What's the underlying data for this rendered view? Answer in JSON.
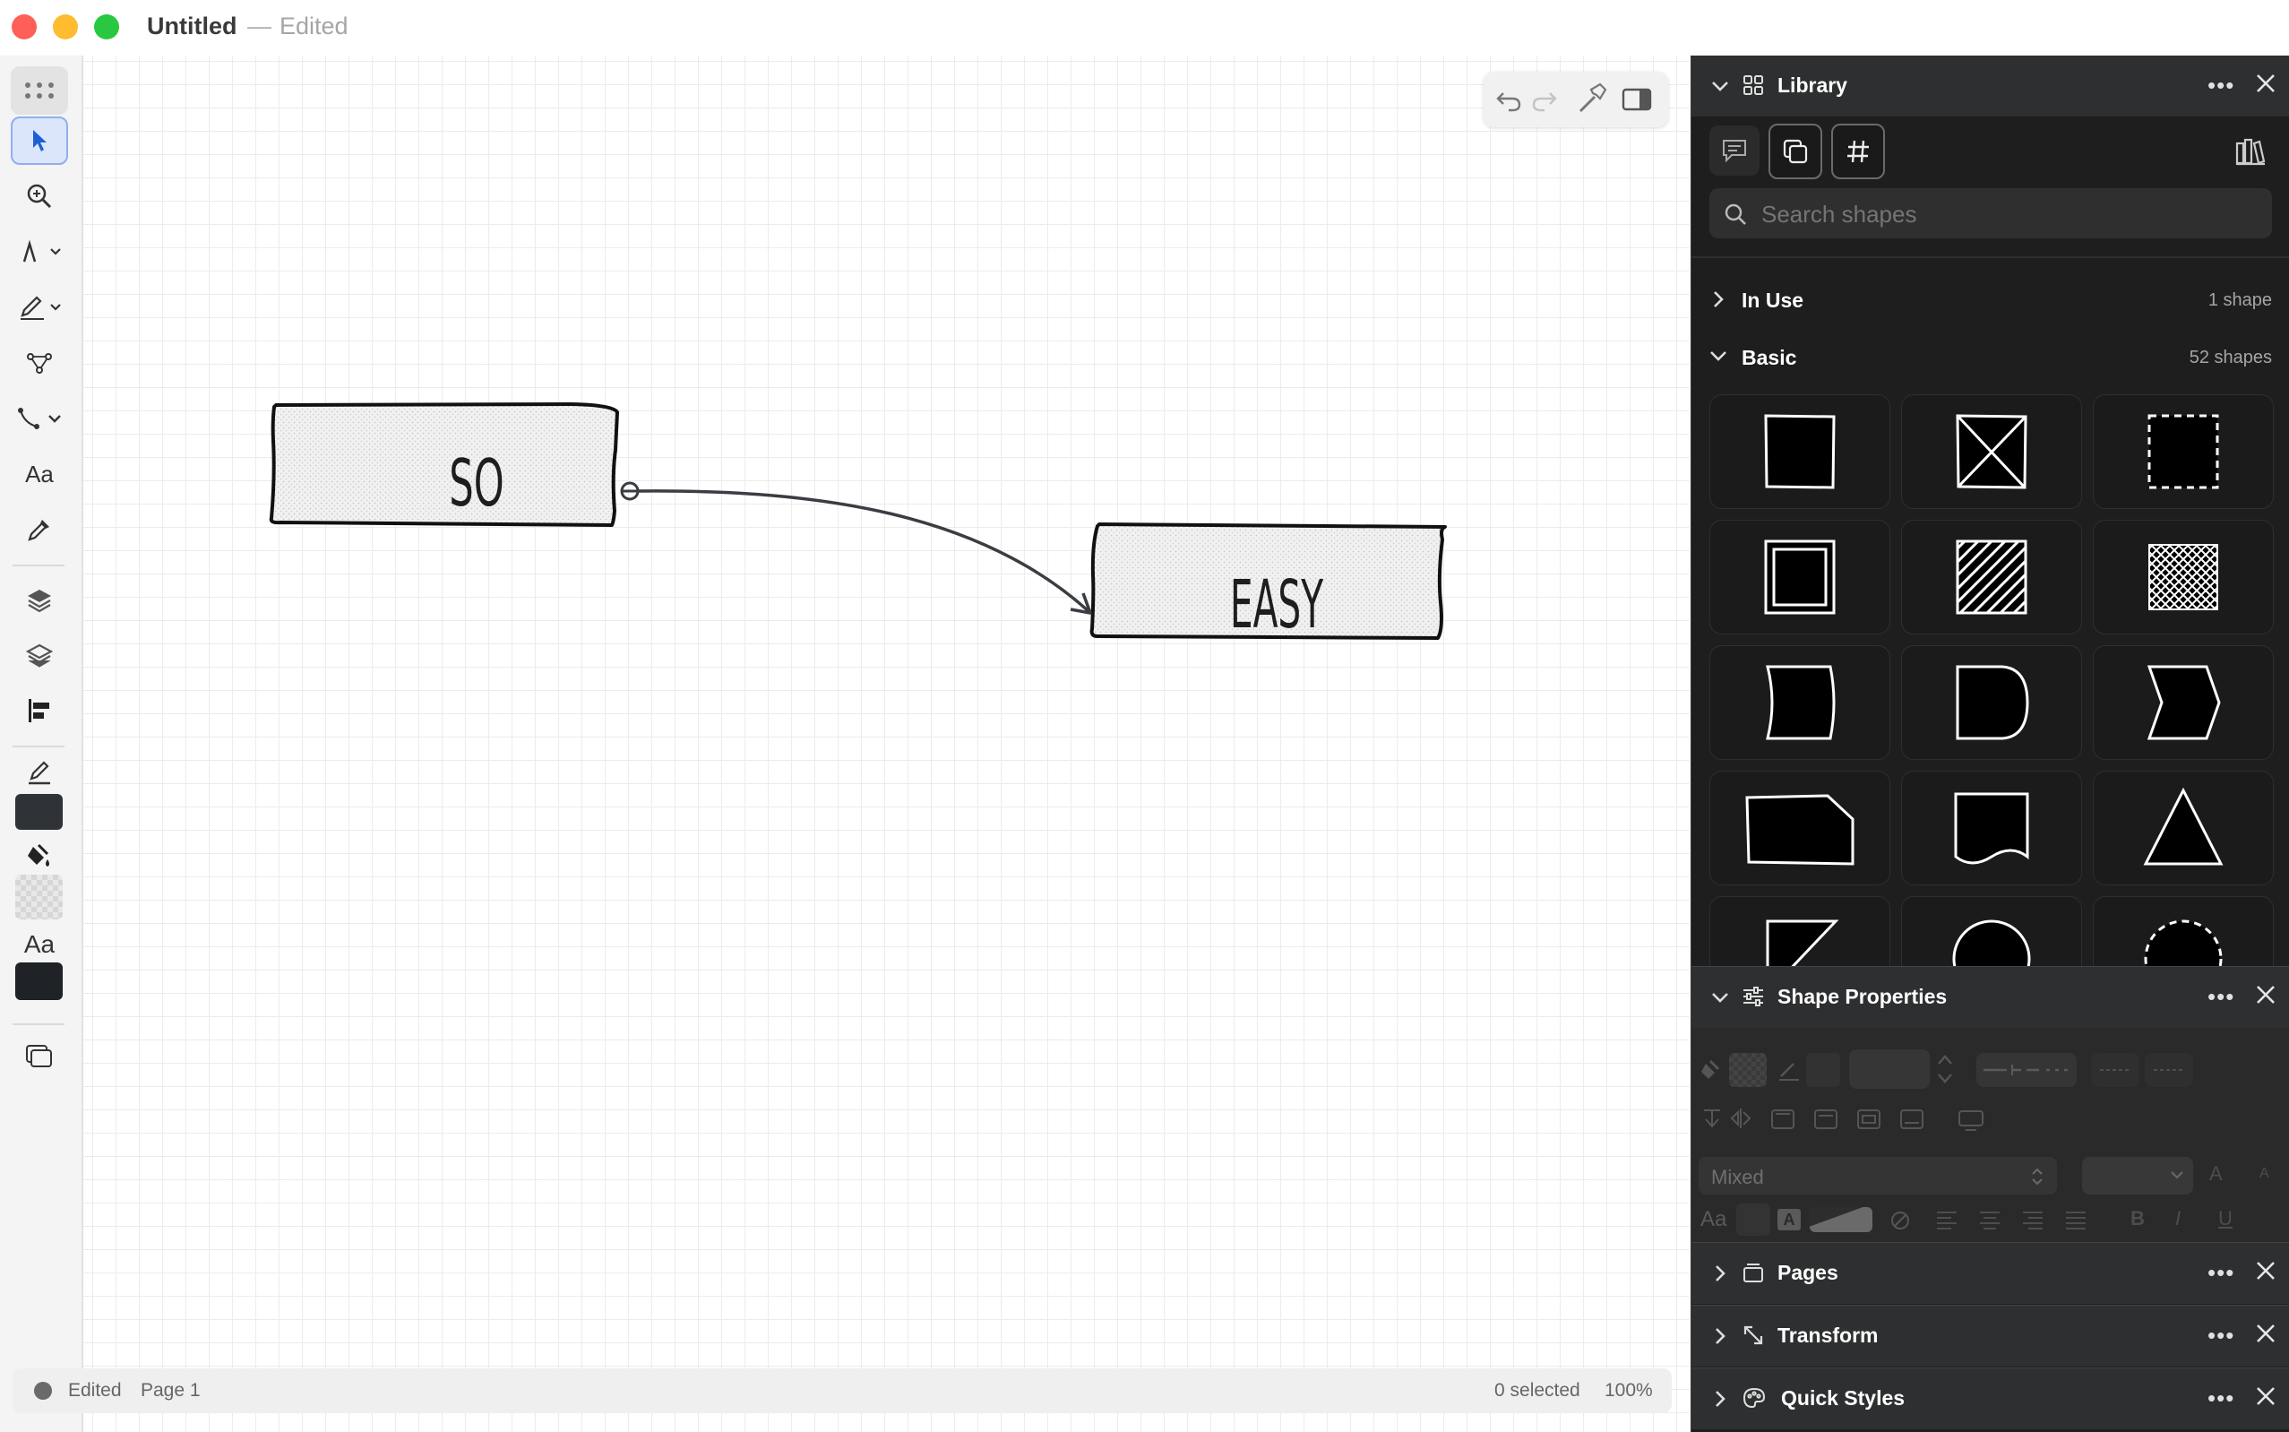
{
  "window": {
    "title": "Untitled",
    "separator": "—",
    "status": "Edited",
    "traffic_lights": {
      "close": "#fe5f57",
      "minimize": "#febc2e",
      "zoom": "#28c840"
    }
  },
  "left_toolbar": {
    "tools": [
      "grid-handle-icon",
      "select-arrow-icon",
      "zoom-icon",
      "pen-tool-icon",
      "pencil-icon",
      "node-edit-icon",
      "connector-icon",
      "text-tool-icon",
      "eyedropper-icon",
      "layers-up-icon",
      "layers-icon",
      "align-icon",
      "stroke-icon",
      "fill-icon",
      "text-style-icon",
      "pages-icon"
    ],
    "text_tool_label": "Aa",
    "text_style_label": "Aa",
    "stroke_color": "#2f3338",
    "text_color": "#1f2226"
  },
  "canvas": {
    "shapes": [
      {
        "label": "SO"
      },
      {
        "label": "EASY"
      }
    ]
  },
  "top_toolbar": {
    "buttons": [
      "undo-icon",
      "redo-icon",
      "tools-icon",
      "sidebar-toggle-icon"
    ]
  },
  "status_bar": {
    "edited": "Edited",
    "page": "Page 1",
    "selected": "0 selected",
    "zoom": "100%"
  },
  "library": {
    "title": "Library",
    "search_placeholder": "Search shapes",
    "sections": [
      {
        "name": "In Use",
        "count": "1 shape",
        "expanded": false
      },
      {
        "name": "Basic",
        "count": "52 shapes",
        "expanded": true
      }
    ],
    "basic_shapes": [
      "rectangle",
      "crossed-rectangle",
      "dashed-rectangle",
      "double-rectangle",
      "hatched-rectangle",
      "crosshatched-rectangle",
      "storage-shape",
      "delay-shape",
      "chevron-shape",
      "snipped-corner-shape",
      "document-shape",
      "triangle",
      "right-triangle",
      "circle",
      "dashed-circle"
    ]
  },
  "shape_properties": {
    "title": "Shape Properties",
    "font_value": "Mixed",
    "text_label": "Aa",
    "style_letters": [
      "B",
      "I",
      "U"
    ],
    "font_size_letters": [
      "A",
      "A"
    ]
  },
  "collapsed_panels": [
    {
      "title": "Pages",
      "icon": "pages-icon"
    },
    {
      "title": "Transform",
      "icon": "transform-icon"
    },
    {
      "title": "Quick Styles",
      "icon": "palette-icon"
    }
  ]
}
